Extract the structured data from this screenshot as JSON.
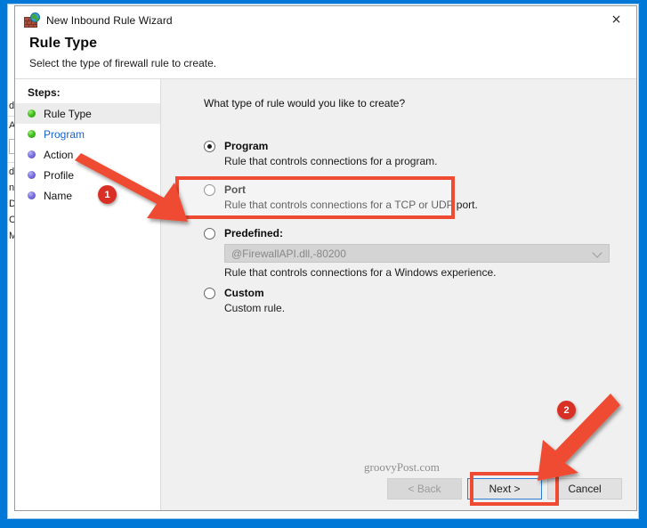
{
  "window": {
    "title": "New Inbound Rule Wizard",
    "icon": "firewall-globe-icon",
    "close_label": "×",
    "accent_blue": "#0078d7"
  },
  "header": {
    "title": "Rule Type",
    "subtitle": "Select the type of firewall rule to create."
  },
  "steps": {
    "title": "Steps:",
    "items": [
      {
        "label": "Rule Type",
        "state": "active",
        "bullet": "green"
      },
      {
        "label": "Program",
        "state": "link",
        "bullet": "green"
      },
      {
        "label": "Action",
        "state": "pending",
        "bullet": "purple"
      },
      {
        "label": "Profile",
        "state": "pending",
        "bullet": "purple"
      },
      {
        "label": "Name",
        "state": "pending",
        "bullet": "purple"
      }
    ]
  },
  "main": {
    "question": "What type of rule would you like to create?",
    "options": [
      {
        "label": "Program",
        "description": "Rule that controls connections for a program.",
        "selected": true
      },
      {
        "label": "Port",
        "description": "Rule that controls connections for a TCP or UDP port.",
        "selected": false
      },
      {
        "label": "Predefined:",
        "description": "Rule that controls connections for a Windows experience.",
        "selected": false,
        "combo_value": "@FirewallAPI.dll,-80200"
      },
      {
        "label": "Custom",
        "description": "Custom rule.",
        "selected": false
      }
    ]
  },
  "footer": {
    "watermark": "groovyPost.com",
    "back_label": "< Back",
    "next_label": "Next >",
    "cancel_label": "Cancel"
  },
  "annotations": {
    "highlight_color": "#ef4b33",
    "badge_color": "#d93025",
    "badge_1": "1",
    "badge_2": "2"
  },
  "background_window": {
    "fragments": [
      "d",
      "Ac",
      "d",
      "n",
      "D",
      "Co",
      "M"
    ]
  }
}
